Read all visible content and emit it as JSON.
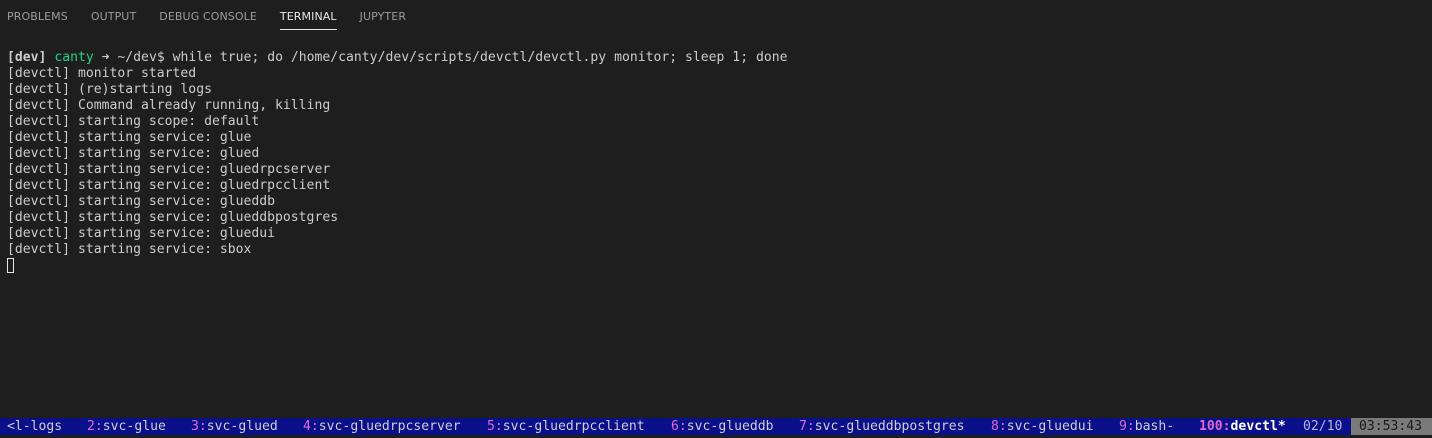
{
  "tabs": [
    {
      "label": "PROBLEMS"
    },
    {
      "label": "OUTPUT"
    },
    {
      "label": "DEBUG CONSOLE"
    },
    {
      "label": "TERMINAL"
    },
    {
      "label": "JUPYTER"
    }
  ],
  "active_tab": "TERMINAL",
  "prompt": {
    "env": "[dev]",
    "user": "canty",
    "arrow": "➜",
    "cwd": "~/dev$",
    "command": "while true; do /home/canty/dev/scripts/devctl/devctl.py monitor; sleep 1; done"
  },
  "output_lines": [
    "[devctl] monitor started",
    "[devctl] (re)starting logs",
    "[devctl] Command already running, killing",
    "[devctl] starting scope: default",
    "[devctl] starting service: glue",
    "[devctl] starting service: glued",
    "[devctl] starting service: gluedrpcserver",
    "[devctl] starting service: gluedrpcclient",
    "[devctl] starting service: glueddb",
    "[devctl] starting service: glueddbpostgres",
    "[devctl] starting service: gluedui",
    "[devctl] starting service: sbox"
  ],
  "status_bar": {
    "windows": [
      {
        "num": "",
        "name": "<l-logs"
      },
      {
        "num": "2:",
        "name": "svc-glue"
      },
      {
        "num": "3:",
        "name": "svc-glued"
      },
      {
        "num": "4:",
        "name": "svc-gluedrpcserver"
      },
      {
        "num": "5:",
        "name": "svc-gluedrpcclient"
      },
      {
        "num": "6:",
        "name": "svc-glueddb"
      },
      {
        "num": "7:",
        "name": "svc-glueddbpostgres"
      },
      {
        "num": "8:",
        "name": "svc-gluedui"
      },
      {
        "num": "9:",
        "name": "bash-"
      },
      {
        "num": "100:",
        "name": "devctl*",
        "active": true
      }
    ],
    "window_count": "02/10",
    "clock": "03:53:43"
  },
  "colors": {
    "background": "#1e1e1e",
    "prompt_user": "#23d18b",
    "status_bg": "#0a0f8a",
    "status_window_number": "#e06ad1",
    "clock_bg": "#7a7a7a"
  }
}
